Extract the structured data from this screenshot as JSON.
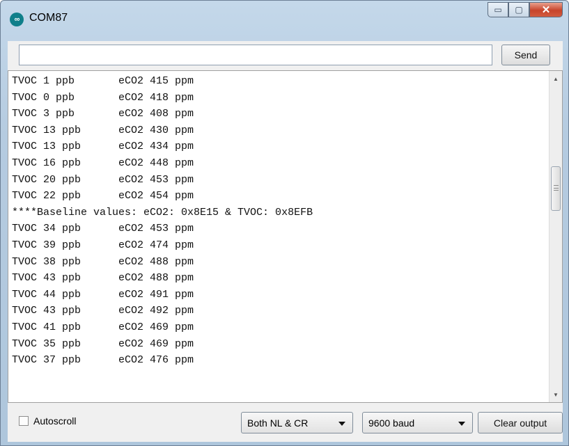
{
  "window": {
    "title": "COM87",
    "minimize_glyph": "▭",
    "maximize_glyph": "▢",
    "close_glyph": "✕",
    "icon": "arduino-icon",
    "icon_glyph": "∞"
  },
  "input": {
    "value": "",
    "placeholder": "",
    "send_label": "Send"
  },
  "output": {
    "lines": [
      "TVOC 1 ppb       eCO2 415 ppm",
      "TVOC 0 ppb       eCO2 418 ppm",
      "TVOC 3 ppb       eCO2 408 ppm",
      "TVOC 13 ppb      eCO2 430 ppm",
      "TVOC 13 ppb      eCO2 434 ppm",
      "TVOC 16 ppb      eCO2 448 ppm",
      "TVOC 20 ppb      eCO2 453 ppm",
      "TVOC 22 ppb      eCO2 454 ppm",
      "****Baseline values: eCO2: 0x8E15 & TVOC: 0x8EFB",
      "TVOC 34 ppb      eCO2 453 ppm",
      "TVOC 39 ppb      eCO2 474 ppm",
      "TVOC 38 ppb      eCO2 488 ppm",
      "TVOC 43 ppb      eCO2 488 ppm",
      "TVOC 44 ppb      eCO2 491 ppm",
      "TVOC 43 ppb      eCO2 492 ppm",
      "TVOC 41 ppb      eCO2 469 ppm",
      "TVOC 35 ppb      eCO2 469 ppm",
      "TVOC 37 ppb      eCO2 476 ppm"
    ]
  },
  "footer": {
    "autoscroll_label": "Autoscroll",
    "autoscroll_checked": false,
    "line_ending": "Both NL & CR",
    "baud_rate": "9600 baud",
    "clear_label": "Clear output"
  },
  "scrollbar": {
    "up_glyph": "▲",
    "down_glyph": "▼"
  }
}
